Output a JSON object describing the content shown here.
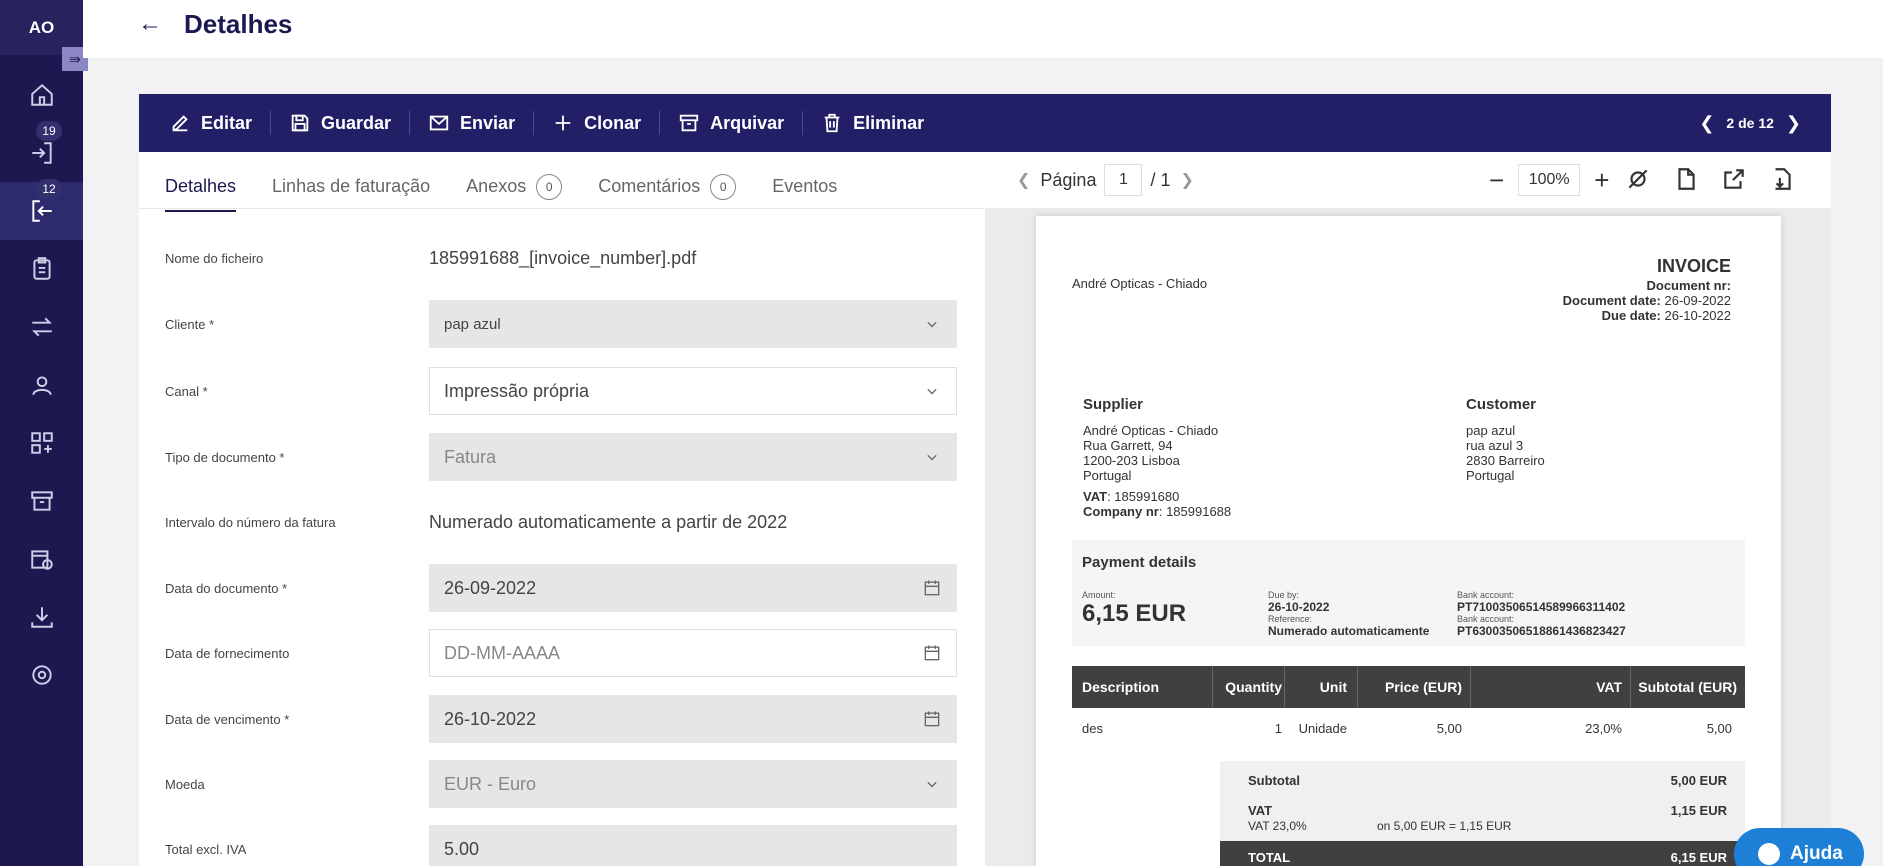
{
  "user": {
    "initials": "AO"
  },
  "sidebar": {
    "items": [
      {
        "name": "home",
        "badge": ""
      },
      {
        "name": "inbox",
        "badge": "19"
      },
      {
        "name": "outbox",
        "badge": "12"
      },
      {
        "name": "clipboard",
        "badge": ""
      },
      {
        "name": "transfer",
        "badge": ""
      },
      {
        "name": "contacts",
        "badge": ""
      },
      {
        "name": "apps",
        "badge": ""
      },
      {
        "name": "archive",
        "badge": ""
      },
      {
        "name": "schedule",
        "badge": ""
      },
      {
        "name": "download",
        "badge": ""
      },
      {
        "name": "settings",
        "badge": ""
      }
    ]
  },
  "header": {
    "title": "Detalhes"
  },
  "toolbar": {
    "edit": "Editar",
    "save": "Guardar",
    "send": "Enviar",
    "clone": "Clonar",
    "archive": "Arquivar",
    "delete": "Eliminar",
    "pager": "2 de 12"
  },
  "tabs": {
    "details": "Detalhes",
    "lines": "Linhas de faturação",
    "attachments": "Anexos",
    "attachments_count": "0",
    "comments": "Comentários",
    "comments_count": "0",
    "events": "Eventos"
  },
  "form": {
    "filename_label": "Nome do ficheiro",
    "filename_value": "185991688_[invoice_number].pdf",
    "client_label": "Cliente *",
    "client_value": "pap azul",
    "channel_label": "Canal *",
    "channel_value": "Impressão própria",
    "doctype_label": "Tipo de documento *",
    "doctype_value": "Fatura",
    "range_label": "Intervalo do número da fatura",
    "range_value": "Numerado automaticamente a partir de 2022",
    "docdate_label": "Data do documento *",
    "docdate_value": "26-09-2022",
    "supplydate_label": "Data de fornecimento",
    "supplydate_placeholder": "DD-MM-AAAA",
    "duedate_label": "Data de vencimento *",
    "duedate_value": "26-10-2022",
    "currency_label": "Moeda",
    "currency_value": "EUR - Euro",
    "total_label": "Total excl. IVA",
    "total_value": "5.00"
  },
  "preview": {
    "page_label": "Página",
    "page_current": "1",
    "page_total": "/ 1",
    "zoom": "100%"
  },
  "invoice": {
    "title": "INVOICE",
    "docnr_label": "Document nr:",
    "docdate_label": "Document date:",
    "docdate_value": "26-09-2022",
    "duedate_label": "Due date:",
    "duedate_value": "26-10-2022",
    "seller": "André Opticas - Chiado",
    "supplier_title": "Supplier",
    "supplier_lines": [
      "André Opticas - Chiado",
      "Rua Garrett, 94",
      "1200-203 Lisboa",
      "Portugal"
    ],
    "vat_label": "VAT",
    "vat_value": ": 185991680",
    "company_label": "Company nr",
    "company_value": ": 185991688",
    "customer_title": "Customer",
    "customer_lines": [
      "pap azul",
      "rua azul 3",
      "2830 Barreiro",
      "Portugal"
    ],
    "payment_title": "Payment details",
    "amount_label": "Amount:",
    "amount_value": "6,15 EUR",
    "dueby_label": "Due by:",
    "dueby_value": "26-10-2022",
    "reference_label": "Reference:",
    "reference_value": "Numerado automaticamente",
    "bank_label_1": "Bank account:",
    "bank_value_1": "PT71003506514589966311402",
    "bank_label_2": "Bank account:",
    "bank_value_2": "PT63003506518861436823427",
    "columns": [
      "Description",
      "Quantity",
      "Unit",
      "Price (EUR)",
      "VAT",
      "Subtotal (EUR)"
    ],
    "rows": [
      [
        "des",
        "1",
        "Unidade",
        "5,00",
        "23,0%",
        "5,00"
      ]
    ],
    "subtotal_label": "Subtotal",
    "subtotal_value": "5,00 EUR",
    "vat_total_label": "VAT",
    "vat_total_value": "1,15 EUR",
    "vat_rate_label": "VAT 23,0%",
    "vat_calc": "on 5,00 EUR = 1,15 EUR",
    "total_label": "TOTAL",
    "total_value": "6,15 EUR"
  },
  "help": {
    "label": "Ajuda"
  }
}
